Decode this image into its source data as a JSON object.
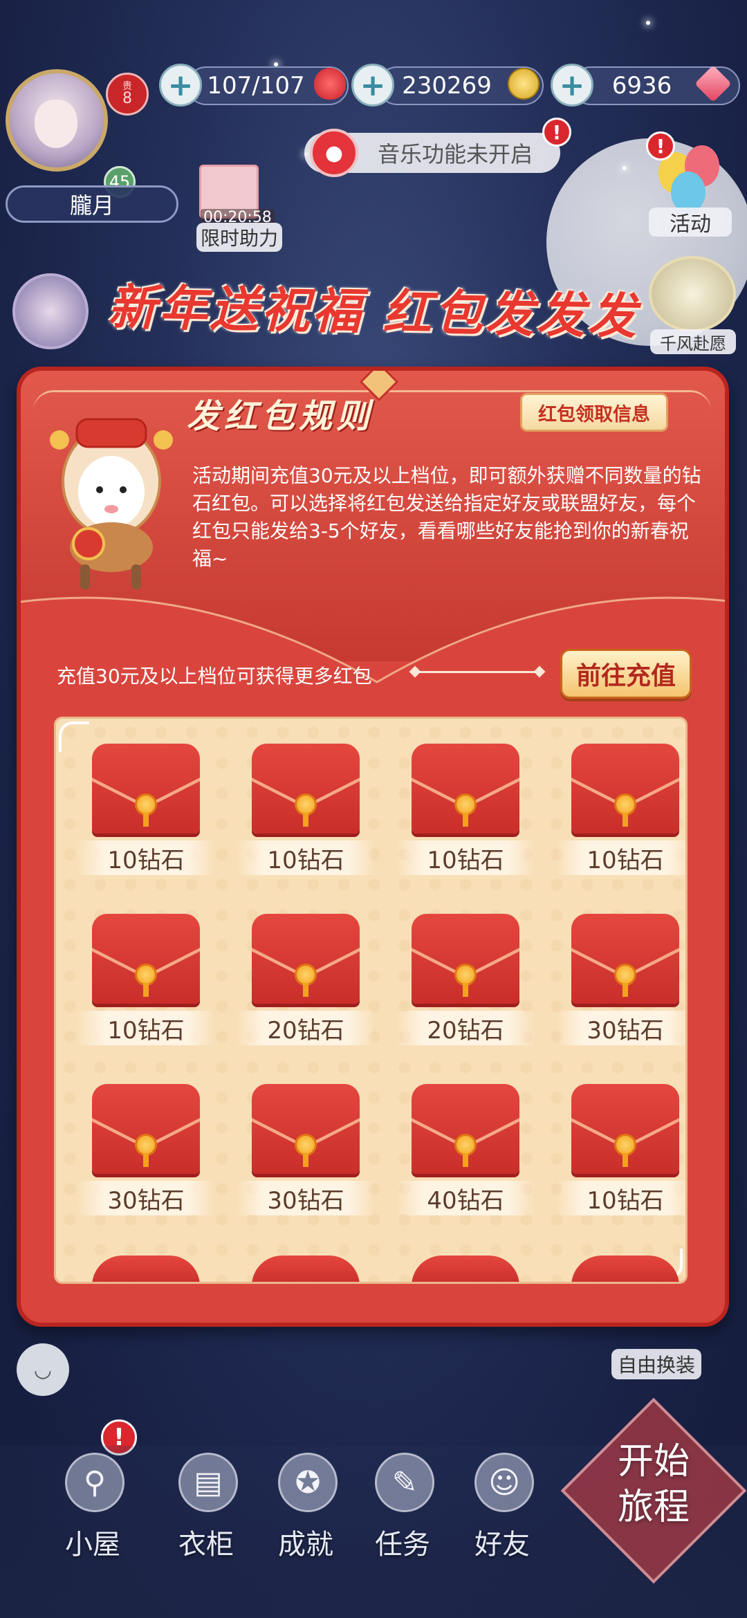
{
  "top_bar": {
    "vip_level": "8",
    "player_level": "45",
    "player_name": "朧月",
    "stamina": "107/107",
    "gold": "230269",
    "diamonds": "6936",
    "music_status": "音乐功能未开启",
    "limited_help_timer": "00:20:58",
    "limited_help_label": "限时助力",
    "activity_label": "活动",
    "qianfeng_label": "千风赴愿"
  },
  "banner": {
    "title": "新年送祝福 红包发发发"
  },
  "panel": {
    "rules_title": "发红包规则",
    "info_button": "红包领取信息",
    "rules_text": "活动期间充值30元及以上档位，即可额外获赠不同数量的钻石红包。可以选择将红包发送给指定好友或联盟好友，每个红包只能发给3-5个好友，看看哪些好友能抢到你的新春祝福~",
    "recharge_note": "充值30元及以上档位可获得更多红包",
    "recharge_button": "前往充值",
    "envelopes": [
      {
        "label": "10钻石"
      },
      {
        "label": "10钻石"
      },
      {
        "label": "10钻石"
      },
      {
        "label": "10钻石"
      },
      {
        "label": "10钻石"
      },
      {
        "label": "20钻石"
      },
      {
        "label": "20钻石"
      },
      {
        "label": "30钻石"
      },
      {
        "label": "30钻石"
      },
      {
        "label": "30钻石"
      },
      {
        "label": "40钻石"
      },
      {
        "label": "10钻石"
      }
    ]
  },
  "bottom": {
    "free_change": "自由换装",
    "nav": [
      {
        "label": "小屋",
        "icon": "bicycle-icon"
      },
      {
        "label": "衣柜",
        "icon": "wardrobe-icon"
      },
      {
        "label": "成就",
        "icon": "medal-icon"
      },
      {
        "label": "任务",
        "icon": "task-icon"
      },
      {
        "label": "好友",
        "icon": "friends-icon"
      }
    ],
    "start_journey": "开始旅程"
  },
  "colors": {
    "panel_red": "#d9453d",
    "grid_cream": "#f8dfb8",
    "accent_gold": "#f4c46f"
  }
}
